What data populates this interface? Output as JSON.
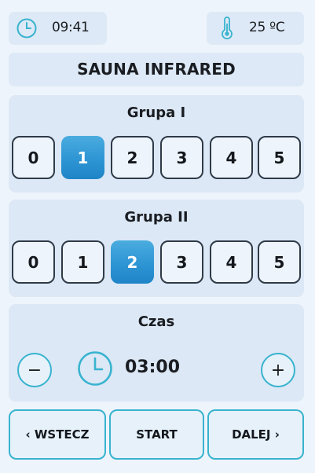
{
  "status_bar": {
    "time": "09:41",
    "temperature": "25 ºC",
    "time_icon": "clock-icon",
    "temperature_icon": "thermometer-icon"
  },
  "title": "SAUNA INFRARED",
  "groups": [
    {
      "label": "Grupa I",
      "options": [
        "0",
        "1",
        "2",
        "3",
        "4",
        "5"
      ],
      "selected": "1"
    },
    {
      "label": "Grupa II",
      "options": [
        "0",
        "1",
        "2",
        "3",
        "4",
        "5"
      ],
      "selected": "2"
    }
  ],
  "timer": {
    "label": "Czas",
    "value": "03:00",
    "minus_label": "−",
    "plus_label": "+",
    "icon": "clock-icon"
  },
  "nav": {
    "back_label": "‹ WSTECZ",
    "start_label": "START",
    "next_label": "DALEJ ›"
  },
  "colors": {
    "background": "#eef4fb",
    "panel": "#dce8f5",
    "accent": "#38b3cf",
    "selected": "#2e95d4"
  }
}
